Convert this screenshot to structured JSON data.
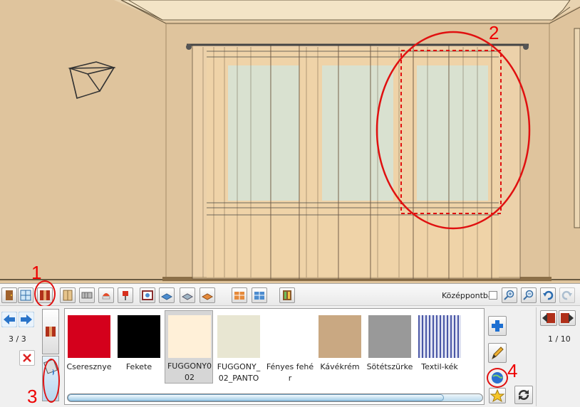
{
  "toolbar": {
    "center_label": "Középpontba",
    "center_checked": false,
    "tools": [
      "door-icon",
      "window-icon",
      "curtain-icon",
      "wardrobe-icon",
      "radiator-icon",
      "lamp-icon",
      "wall-lamp-icon",
      "picture-icon",
      "floor-blue-icon",
      "floor-grey-icon",
      "floor-orange-icon",
      "tile-orange-icon",
      "tile-blue-icon",
      "cabinet-icon"
    ],
    "right_tools": [
      "zoom-in-icon",
      "zoom-out-icon",
      "undo-icon",
      "redo-icon"
    ]
  },
  "left_panel": {
    "page": "3 / 3",
    "modes": [
      "curtain-mode-icon",
      "paint-bucket-icon"
    ]
  },
  "swatches": [
    {
      "name": "Cseresznye",
      "color": "#d4001c",
      "selected": false
    },
    {
      "name": "Fekete",
      "color": "#000000",
      "selected": false
    },
    {
      "name": "FUGGONY0 02",
      "color": "#fff0d8",
      "selected": true
    },
    {
      "name": "FUGGONY_ 02_PANTO",
      "color": "#e8e6d2",
      "selected": false
    },
    {
      "name": "Fényes fehér",
      "color": "#ffffff",
      "selected": false
    },
    {
      "name": "Kávékrém",
      "color": "#c9a882",
      "selected": false
    },
    {
      "name": "Sötétszürke",
      "color": "#999999",
      "selected": false
    },
    {
      "name": "Textil-kék",
      "color": "pattern",
      "selected": false
    }
  ],
  "right_panel": {
    "page": "1 / 10",
    "actions": [
      "add-icon",
      "pencil-icon",
      "globe-icon",
      "star-icon"
    ]
  },
  "scroll": {
    "position": 0.9
  },
  "annotations": [
    "1",
    "2",
    "3",
    "4"
  ]
}
